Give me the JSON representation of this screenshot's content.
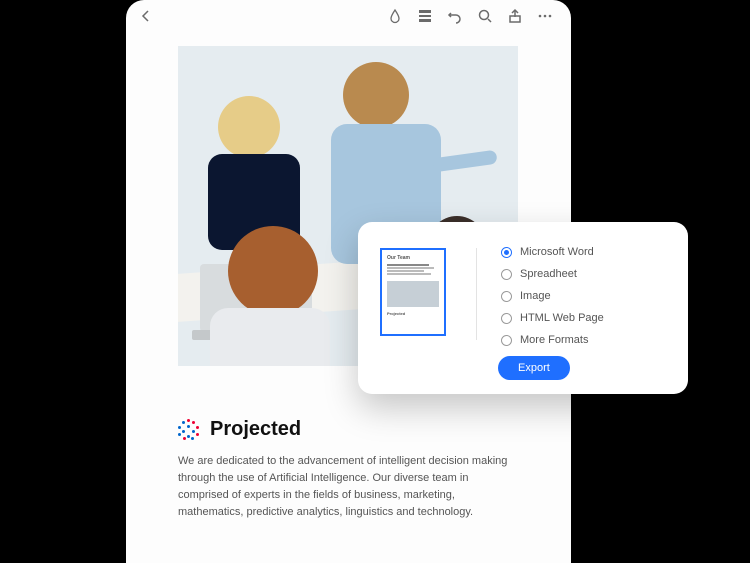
{
  "document": {
    "brand": "Projected",
    "description": "We are dedicated to the advancement of intelligent decision making through the use of Artificial Intelligence. Our diverse team in comprised of experts in the fields of business,  marketing, mathematics, predictive analytics, linguistics and technology."
  },
  "exportPanel": {
    "thumbnail": {
      "title": "Our Team",
      "brand": "Projected"
    },
    "options": [
      {
        "label": "Microsoft Word",
        "selected": true
      },
      {
        "label": "Spreadheet",
        "selected": false
      },
      {
        "label": "Image",
        "selected": false
      },
      {
        "label": "HTML Web Page",
        "selected": false
      },
      {
        "label": "More Formats",
        "selected": false
      }
    ],
    "exportLabel": "Export"
  }
}
